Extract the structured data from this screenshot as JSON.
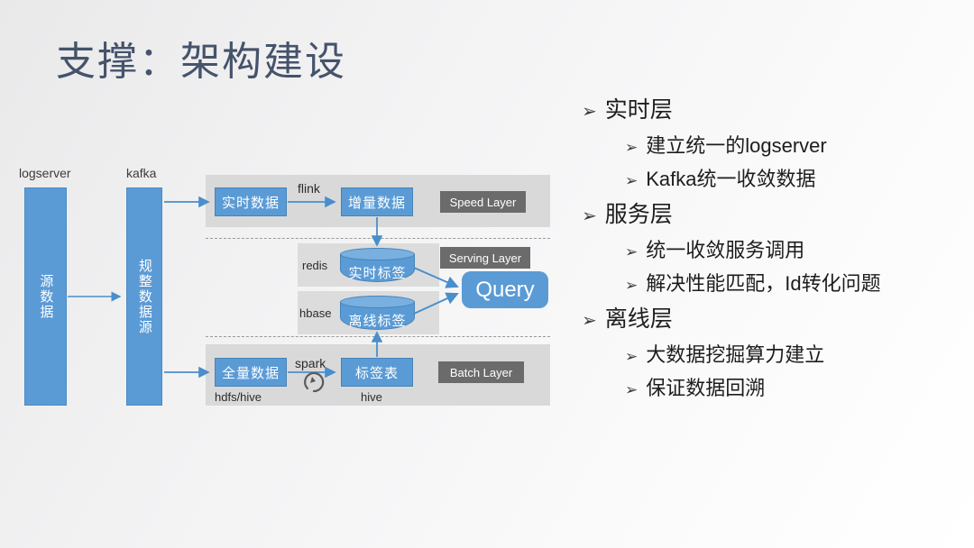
{
  "slide": {
    "title": "支撑：架构建设",
    "title_color": "#45536B",
    "accent_blue": "#5B9BD5",
    "panel_gray": "#D9D9D9",
    "badge_gray": "#6B6B6B"
  },
  "diagram": {
    "column_labels": {
      "logserver": "logserver",
      "kafka": "kafka"
    },
    "bars": [
      {
        "name": "source-data-bar",
        "label": "源数据"
      },
      {
        "name": "normalized-source-bar",
        "label": "规整数据源"
      }
    ],
    "speed_layer": {
      "badge": "Speed Layer",
      "node_in": "实时数据",
      "edge_label": "flink",
      "node_out": "增量数据"
    },
    "serving_layer": {
      "badge": "Serving Layer",
      "store_realtime_label": "redis",
      "store_realtime_node": "实时标签",
      "store_offline_label": "hbase",
      "store_offline_node": "离线标签",
      "query_node": "Query"
    },
    "batch_layer": {
      "badge": "Batch Layer",
      "node_in": "全量数据",
      "node_in_sub": "hdfs/hive",
      "edge_label": "spark",
      "edge_icon": "refresh-loop-icon",
      "node_out": "标签表",
      "node_out_sub": "hive"
    }
  },
  "bullets": {
    "marker": "➢",
    "items": [
      {
        "level": 1,
        "text": "实时层"
      },
      {
        "level": 2,
        "text": "建立统一的logserver"
      },
      {
        "level": 2,
        "text": "Kafka统一收敛数据"
      },
      {
        "level": 1,
        "text": "服务层"
      },
      {
        "level": 2,
        "text": "统一收敛服务调用"
      },
      {
        "level": 2,
        "text": "解决性能匹配，Id转化问题"
      },
      {
        "level": 1,
        "text": "离线层"
      },
      {
        "level": 2,
        "text": "大数据挖掘算力建立"
      },
      {
        "level": 2,
        "text": "保证数据回溯"
      }
    ]
  }
}
